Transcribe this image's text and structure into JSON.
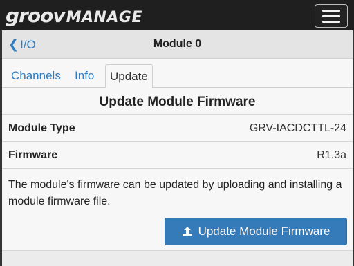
{
  "header": {
    "brand_groov": "groov",
    "brand_manage": "MANAGE",
    "menu_icon": "hamburger-menu-icon"
  },
  "navbar": {
    "back_label": "I/O",
    "title": "Module 0"
  },
  "tabs": [
    {
      "label": "Channels",
      "active": false
    },
    {
      "label": "Info",
      "active": false
    },
    {
      "label": "Update",
      "active": true
    }
  ],
  "section": {
    "title": "Update Module Firmware"
  },
  "details": [
    {
      "label": "Module Type",
      "value": "GRV-IACDCTTL-24"
    },
    {
      "label": "Firmware",
      "value": "R1.3a"
    }
  ],
  "description": "The module's firmware can be updated by uploading and installing a module firmware file.",
  "update_button": {
    "label": "Update Module Firmware",
    "icon": "upload-icon"
  },
  "colors": {
    "accent": "#2f7cc1",
    "button": "#357ab9",
    "topbar": "#1f1f1f"
  }
}
